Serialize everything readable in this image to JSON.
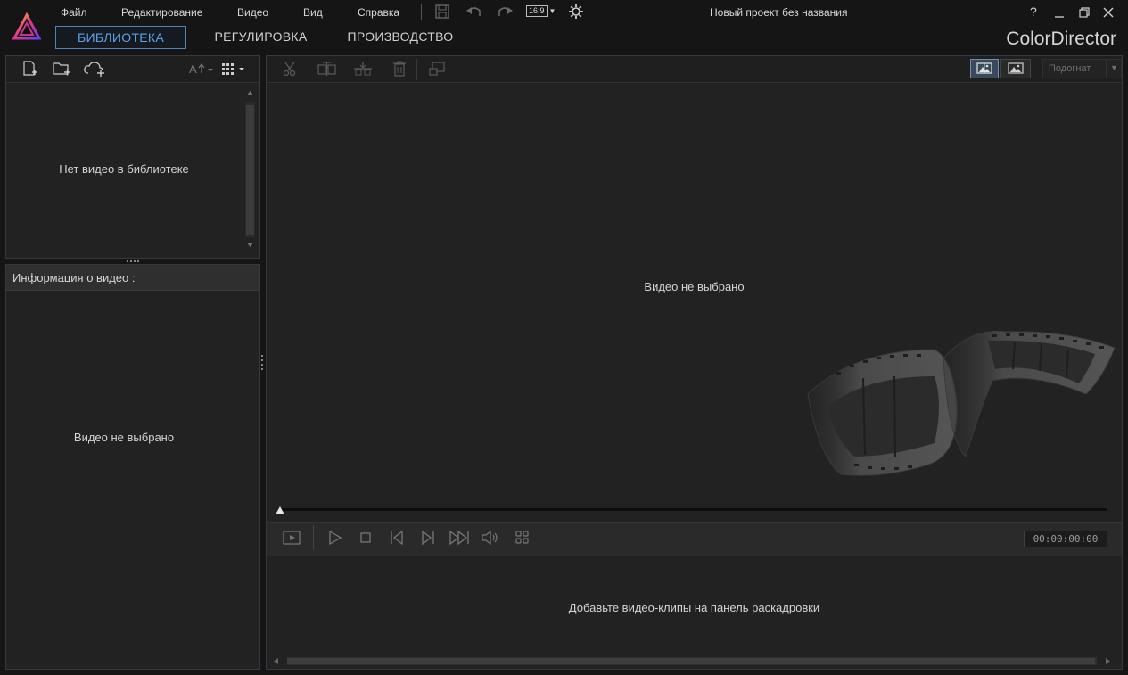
{
  "menu": {
    "file": "Файл",
    "edit": "Редактирование",
    "video": "Видео",
    "view": "Вид",
    "help": "Справка",
    "aspect_ratio": "16:9"
  },
  "window": {
    "title": "Новый проект без названия",
    "help": "?"
  },
  "tabs": {
    "library": "БИБЛИОТЕКА",
    "adjust": "РЕГУЛИРОВКА",
    "produce": "ПРОИЗВОДСТВО"
  },
  "brand": "ColorDirector",
  "library_panel": {
    "empty_text": "Нет видео в библиотеке"
  },
  "info_panel": {
    "header": "Информация о видео :",
    "empty_text": "Видео не выбрано"
  },
  "preview": {
    "empty_text": "Видео не выбрано",
    "fit_label": "Подогнат"
  },
  "player": {
    "timecode": "00:00:00:00"
  },
  "storyboard": {
    "empty_text": "Добавьте видео-клипы на панель раскадровки"
  },
  "colors": {
    "accent": "#4f83b5",
    "background": "#151515",
    "panel": "#222222"
  }
}
